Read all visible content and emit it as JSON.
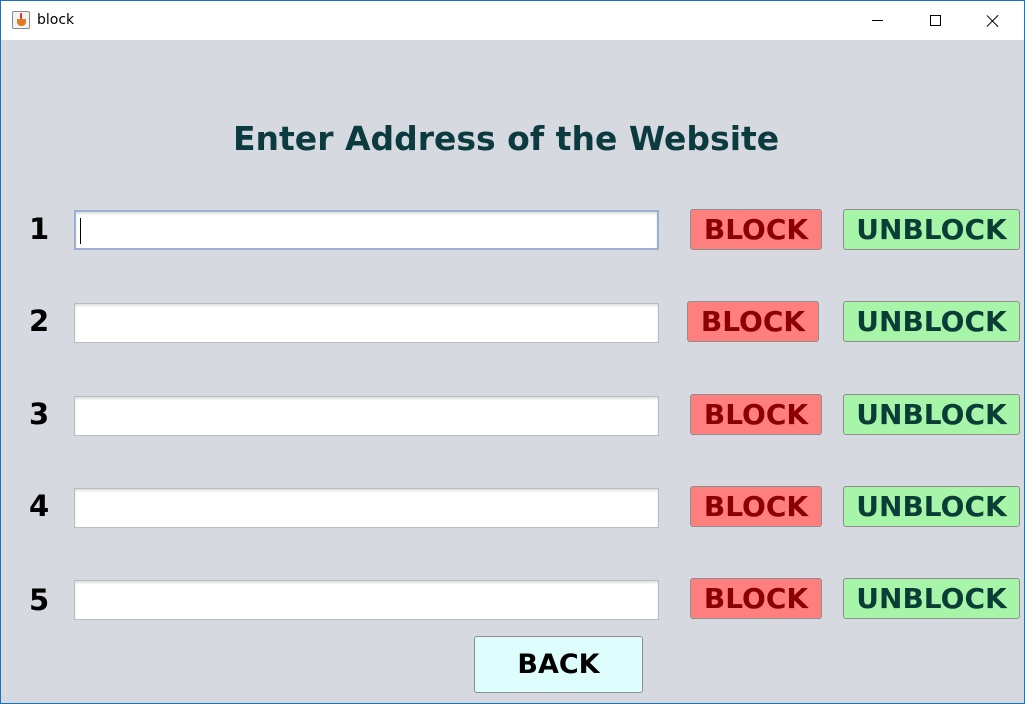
{
  "window": {
    "title": "block",
    "controls": [
      "minimize-icon",
      "maximize-icon",
      "close-icon"
    ]
  },
  "heading": "Enter Address of the Website",
  "rows": [
    {
      "number": "1",
      "value": "",
      "block_label": "BLOCK",
      "unblock_label": "UNBLOCK"
    },
    {
      "number": "2",
      "value": "",
      "block_label": "BLOCK",
      "unblock_label": "UNBLOCK"
    },
    {
      "number": "3",
      "value": "",
      "block_label": "BLOCK",
      "unblock_label": "UNBLOCK"
    },
    {
      "number": "4",
      "value": "",
      "block_label": "BLOCK",
      "unblock_label": "UNBLOCK"
    },
    {
      "number": "5",
      "value": "",
      "block_label": "BLOCK",
      "unblock_label": "UNBLOCK"
    }
  ],
  "back_label": "BACK",
  "colors": {
    "background": "#d6d9e0",
    "heading": "#0b3a3f",
    "block_bg": "#ff7e7e",
    "block_text": "#8b0000",
    "unblock_bg": "#a6f5a8",
    "unblock_text": "#0a3d36",
    "back_bg": "#defdfd"
  }
}
